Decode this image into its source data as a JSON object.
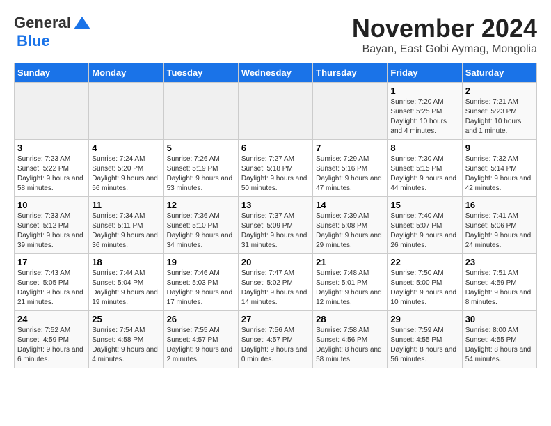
{
  "header": {
    "logo_general": "General",
    "logo_blue": "Blue",
    "month": "November 2024",
    "location": "Bayan, East Gobi Aymag, Mongolia"
  },
  "weekdays": [
    "Sunday",
    "Monday",
    "Tuesday",
    "Wednesday",
    "Thursday",
    "Friday",
    "Saturday"
  ],
  "weeks": [
    [
      {
        "day": "",
        "info": ""
      },
      {
        "day": "",
        "info": ""
      },
      {
        "day": "",
        "info": ""
      },
      {
        "day": "",
        "info": ""
      },
      {
        "day": "",
        "info": ""
      },
      {
        "day": "1",
        "info": "Sunrise: 7:20 AM\nSunset: 5:25 PM\nDaylight: 10 hours and 4 minutes."
      },
      {
        "day": "2",
        "info": "Sunrise: 7:21 AM\nSunset: 5:23 PM\nDaylight: 10 hours and 1 minute."
      }
    ],
    [
      {
        "day": "3",
        "info": "Sunrise: 7:23 AM\nSunset: 5:22 PM\nDaylight: 9 hours and 58 minutes."
      },
      {
        "day": "4",
        "info": "Sunrise: 7:24 AM\nSunset: 5:20 PM\nDaylight: 9 hours and 56 minutes."
      },
      {
        "day": "5",
        "info": "Sunrise: 7:26 AM\nSunset: 5:19 PM\nDaylight: 9 hours and 53 minutes."
      },
      {
        "day": "6",
        "info": "Sunrise: 7:27 AM\nSunset: 5:18 PM\nDaylight: 9 hours and 50 minutes."
      },
      {
        "day": "7",
        "info": "Sunrise: 7:29 AM\nSunset: 5:16 PM\nDaylight: 9 hours and 47 minutes."
      },
      {
        "day": "8",
        "info": "Sunrise: 7:30 AM\nSunset: 5:15 PM\nDaylight: 9 hours and 44 minutes."
      },
      {
        "day": "9",
        "info": "Sunrise: 7:32 AM\nSunset: 5:14 PM\nDaylight: 9 hours and 42 minutes."
      }
    ],
    [
      {
        "day": "10",
        "info": "Sunrise: 7:33 AM\nSunset: 5:12 PM\nDaylight: 9 hours and 39 minutes."
      },
      {
        "day": "11",
        "info": "Sunrise: 7:34 AM\nSunset: 5:11 PM\nDaylight: 9 hours and 36 minutes."
      },
      {
        "day": "12",
        "info": "Sunrise: 7:36 AM\nSunset: 5:10 PM\nDaylight: 9 hours and 34 minutes."
      },
      {
        "day": "13",
        "info": "Sunrise: 7:37 AM\nSunset: 5:09 PM\nDaylight: 9 hours and 31 minutes."
      },
      {
        "day": "14",
        "info": "Sunrise: 7:39 AM\nSunset: 5:08 PM\nDaylight: 9 hours and 29 minutes."
      },
      {
        "day": "15",
        "info": "Sunrise: 7:40 AM\nSunset: 5:07 PM\nDaylight: 9 hours and 26 minutes."
      },
      {
        "day": "16",
        "info": "Sunrise: 7:41 AM\nSunset: 5:06 PM\nDaylight: 9 hours and 24 minutes."
      }
    ],
    [
      {
        "day": "17",
        "info": "Sunrise: 7:43 AM\nSunset: 5:05 PM\nDaylight: 9 hours and 21 minutes."
      },
      {
        "day": "18",
        "info": "Sunrise: 7:44 AM\nSunset: 5:04 PM\nDaylight: 9 hours and 19 minutes."
      },
      {
        "day": "19",
        "info": "Sunrise: 7:46 AM\nSunset: 5:03 PM\nDaylight: 9 hours and 17 minutes."
      },
      {
        "day": "20",
        "info": "Sunrise: 7:47 AM\nSunset: 5:02 PM\nDaylight: 9 hours and 14 minutes."
      },
      {
        "day": "21",
        "info": "Sunrise: 7:48 AM\nSunset: 5:01 PM\nDaylight: 9 hours and 12 minutes."
      },
      {
        "day": "22",
        "info": "Sunrise: 7:50 AM\nSunset: 5:00 PM\nDaylight: 9 hours and 10 minutes."
      },
      {
        "day": "23",
        "info": "Sunrise: 7:51 AM\nSunset: 4:59 PM\nDaylight: 9 hours and 8 minutes."
      }
    ],
    [
      {
        "day": "24",
        "info": "Sunrise: 7:52 AM\nSunset: 4:59 PM\nDaylight: 9 hours and 6 minutes."
      },
      {
        "day": "25",
        "info": "Sunrise: 7:54 AM\nSunset: 4:58 PM\nDaylight: 9 hours and 4 minutes."
      },
      {
        "day": "26",
        "info": "Sunrise: 7:55 AM\nSunset: 4:57 PM\nDaylight: 9 hours and 2 minutes."
      },
      {
        "day": "27",
        "info": "Sunrise: 7:56 AM\nSunset: 4:57 PM\nDaylight: 9 hours and 0 minutes."
      },
      {
        "day": "28",
        "info": "Sunrise: 7:58 AM\nSunset: 4:56 PM\nDaylight: 8 hours and 58 minutes."
      },
      {
        "day": "29",
        "info": "Sunrise: 7:59 AM\nSunset: 4:55 PM\nDaylight: 8 hours and 56 minutes."
      },
      {
        "day": "30",
        "info": "Sunrise: 8:00 AM\nSunset: 4:55 PM\nDaylight: 8 hours and 54 minutes."
      }
    ]
  ]
}
